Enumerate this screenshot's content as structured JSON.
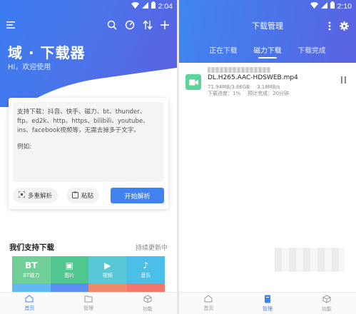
{
  "left_screen": {
    "status_time": "2:04",
    "app_title": "域 · 下载器",
    "app_subtitle": "Hi，欢迎使用",
    "input": {
      "support_text": "支持下载：抖音、快手、磁力、bt、thunder、ftp、ed2k、http、https、bilibili、youtube、ins、facebook视频等，无需去掉多于文字。",
      "example_label": "例如:"
    },
    "buttons": {
      "multi_parse": "多重解析",
      "paste": "粘贴",
      "start_parse": "开始解析"
    },
    "support_section": {
      "title": "我们支持下载",
      "update_note": "持续更新中"
    },
    "tiles": [
      {
        "glyph": "BT",
        "label": "BT磁力",
        "color": "#6fcf97"
      },
      {
        "glyph": "▣",
        "label": "图片",
        "color": "#4fc78f"
      },
      {
        "glyph": "▶",
        "label": "视频",
        "color": "#58c7d6"
      },
      {
        "glyph": "♪",
        "label": "音乐",
        "color": "#4bbfe8"
      }
    ],
    "tile_row2_colors": [
      "#63b7f2",
      "#5a8ff0",
      "#f08a6a",
      "#f2766a"
    ],
    "nav": [
      {
        "label": "首页",
        "active": true
      },
      {
        "label": "管理",
        "active": false
      },
      {
        "label": "功能",
        "active": false
      }
    ]
  },
  "right_screen": {
    "status_time": "2:10",
    "title": "下载管理",
    "tabs": [
      {
        "label": "正在下载",
        "active": false
      },
      {
        "label": "磁力下载",
        "active": true
      },
      {
        "label": "下载完成",
        "active": false
      }
    ],
    "download": {
      "file_name": "DL.H265.AAC-HDSWEB.mp4",
      "size": "71.94MB/3.86GB",
      "speed": "3.18MB/s",
      "progress": "下载进度：1%",
      "remaining": "预计完成：20分钟",
      "progress_fraction": 0.01
    },
    "nav": [
      {
        "label": "首页",
        "active": false
      },
      {
        "label": "管理",
        "active": true
      },
      {
        "label": "功能",
        "active": false
      }
    ]
  },
  "colors": {
    "brand_blue": "#3f82f0",
    "header_gradient_end": "#5a62e2",
    "file_icon_green": "#5fd49a"
  }
}
